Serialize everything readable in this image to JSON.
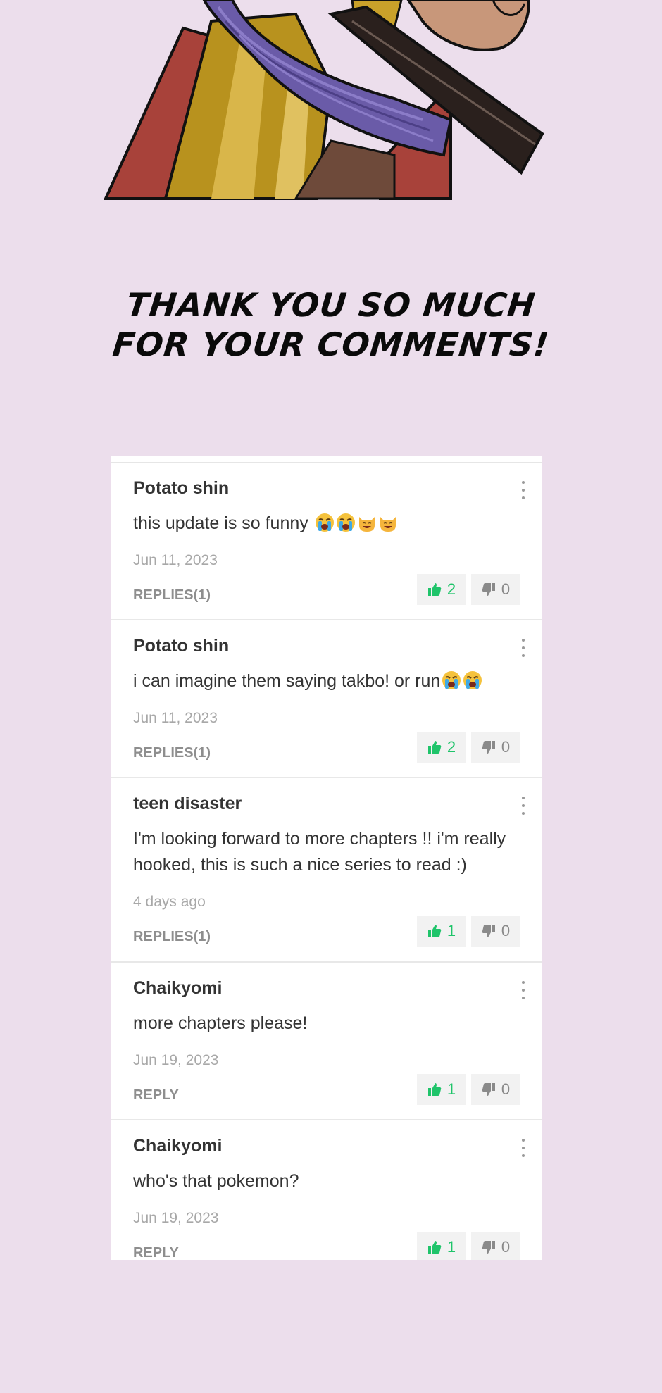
{
  "banner": {
    "line1": "THANK YOU SO MUCH",
    "line2": "FOR YOUR COMMENTS!"
  },
  "colors": {
    "background": "#ecdeec",
    "like": "#1fc46a",
    "dislike": "#8a8a8a"
  },
  "comments": [
    {
      "author": "Potato shin",
      "text": "this update is so funny",
      "emojis": [
        "loudly-crying-face",
        "loudly-crying-face",
        "grinning-cat",
        "grinning-cat"
      ],
      "date": "Jun 11, 2023",
      "reply": "REPLIES(1)",
      "likes": "2",
      "dislikes": "0"
    },
    {
      "author": "Potato shin",
      "text": "i can imagine them saying takbo! or run",
      "emojis": [
        "loudly-crying-face",
        "loudly-crying-face"
      ],
      "date": "Jun 11, 2023",
      "reply": "REPLIES(1)",
      "likes": "2",
      "dislikes": "0"
    },
    {
      "author": "teen disaster",
      "text": "I'm looking forward to more chapters !! i'm really hooked, this is such a nice series to read :)",
      "emojis": [],
      "date": "4 days ago",
      "reply": "REPLIES(1)",
      "likes": "1",
      "dislikes": "0"
    },
    {
      "author": "Chaikyomi",
      "text": "more chapters please!",
      "emojis": [],
      "date": "Jun 19, 2023",
      "reply": "REPLY",
      "likes": "1",
      "dislikes": "0"
    },
    {
      "author": "Chaikyomi",
      "text": "who's that pokemon?",
      "emojis": [],
      "date": "Jun 19, 2023",
      "reply": "REPLY",
      "likes": "1",
      "dislikes": "0"
    }
  ]
}
